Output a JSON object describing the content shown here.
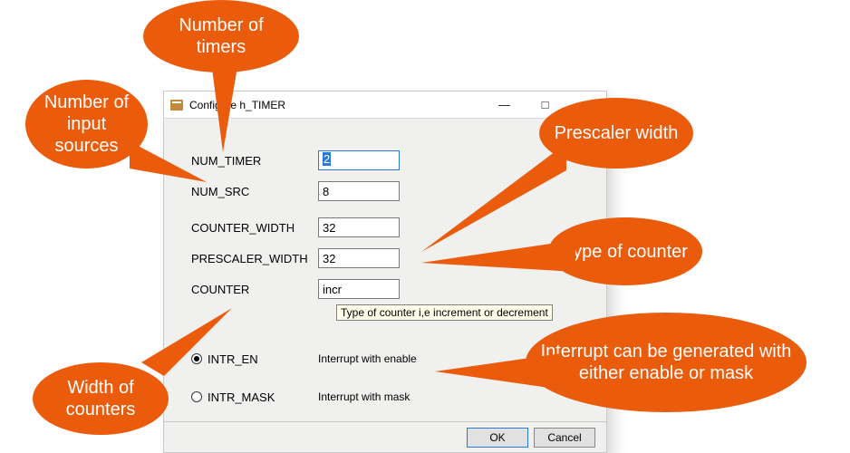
{
  "dialog": {
    "title": "Configure h_TIMER",
    "fields": {
      "num_timer": {
        "label": "NUM_TIMER",
        "value": "2"
      },
      "num_src": {
        "label": "NUM_SRC",
        "value": "8"
      },
      "counter_width": {
        "label": "COUNTER_WIDTH",
        "value": "32"
      },
      "prescaler_width": {
        "label": "PRESCALER_WIDTH",
        "value": "32"
      },
      "counter": {
        "label": "COUNTER",
        "value": "incr"
      }
    },
    "tooltip": "Type of counter  i,e increment or decrement",
    "radios": {
      "intr_en": {
        "label": "INTR_EN",
        "desc": "Interrupt with enable",
        "selected": true
      },
      "intr_mask": {
        "label": "INTR_MASK",
        "desc": "Interrupt with mask",
        "selected": false
      }
    },
    "buttons": {
      "ok": "OK",
      "cancel": "Cancel"
    }
  },
  "callouts": {
    "num_timers": "Number of timers",
    "num_sources": "Number of input sources",
    "prescaler_width": "Prescaler width",
    "counter_type": "Type of counter",
    "counter_width": "Width of counters",
    "interrupt": "Interrupt can be generated with either enable or mask"
  }
}
